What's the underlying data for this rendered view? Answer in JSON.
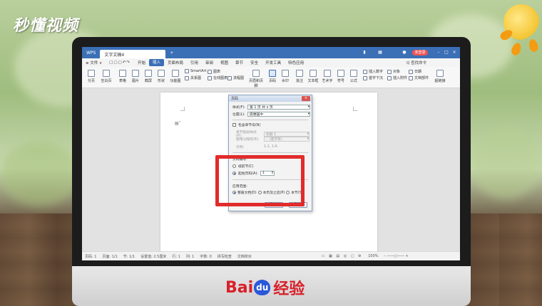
{
  "brand": {
    "logo_text": "秒懂视频"
  },
  "footer": {
    "baidu_bai": "Bai",
    "baidu_du": "du",
    "baidu_cn": "经验"
  },
  "titlebar": {
    "tab_wps": "WPS",
    "tab_doc": "文字文稿4",
    "plus": "+",
    "login": "未登录"
  },
  "menubar": {
    "items": [
      "≡ 文件 ∨",
      "开始",
      "插入",
      "页面布局",
      "引用",
      "审阅",
      "视图",
      "章节",
      "安全",
      "开发工具",
      "特色应用"
    ],
    "search": "Q 查找命令"
  },
  "ribbon": {
    "big_buttons": [
      "分页",
      "空白页",
      "表格",
      "图片",
      "截屏",
      "形状",
      "功能图",
      "页眉和页脚",
      "页码",
      "水印",
      "批注",
      "文本框",
      "艺术字",
      "符号",
      "公式"
    ],
    "small": {
      "smartart": "SmartArt",
      "chart": "图表",
      "online_flow": "在线图表",
      "flowchart": "流程图",
      "insert_number": "插入数字",
      "object": "对象",
      "date": "日期",
      "first_letter": "首字下沉",
      "attachment": "插入附件",
      "doc_parts": "文档部件",
      "hyperlink": "超链接",
      "relation": "关系图"
    }
  },
  "dialog": {
    "title": "页码",
    "style_label": "样式(F):",
    "style_value": "第 1 页 共 x 页",
    "position_label": "位置(L):",
    "position_value": "底端居中",
    "include_chapter": "包含章节号(N)",
    "chapter_style_label": "章节起始样式(P):",
    "chapter_style_value": "标题 1",
    "separator_label": "使用分隔符(E):",
    "separator_value": "-（连字符）",
    "example_label": "示例:",
    "example_value": "1-1, 1-A",
    "numbering_group": "页码编号:",
    "continue_prev": "续前节(C)",
    "start_at": "起始页码(A):",
    "start_value": "1",
    "apply_group": "应用范围:",
    "apply_whole": "整篇文档(D)",
    "apply_this_after": "本页及之后(P)",
    "apply_section": "本节(S)",
    "ok": "确定",
    "cancel": "取消"
  },
  "statusbar": {
    "page": "页码: 1",
    "pages": "页面: 1/1",
    "section": "节: 1/1",
    "setting": "设置值: 2.5厘米",
    "row": "行: 1",
    "col": "列: 1",
    "words": "字数: 0",
    "spell": "拼写检查",
    "docprotect": "文档校对",
    "zoom": "100%"
  }
}
